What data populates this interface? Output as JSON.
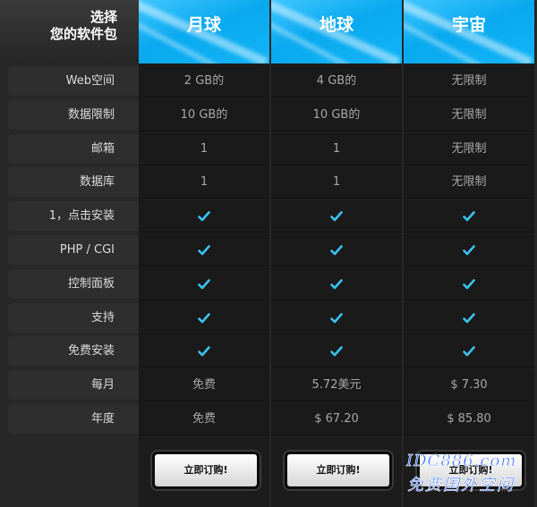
{
  "corner": {
    "line1": "选择",
    "line2": "您的软件包"
  },
  "plans": [
    {
      "name": "月球"
    },
    {
      "name": "地球"
    },
    {
      "name": "宇宙"
    }
  ],
  "rows": [
    {
      "label": "Web空间",
      "values": [
        "2 GB的",
        "4 GB的",
        "无限制"
      ]
    },
    {
      "label": "数据限制",
      "values": [
        "10 GB的",
        "10 GB的",
        "无限制"
      ]
    },
    {
      "label": "邮箱",
      "values": [
        "1",
        "1",
        "无限制"
      ]
    },
    {
      "label": "数据库",
      "values": [
        "1",
        "1",
        "无限制"
      ]
    },
    {
      "label": "1，点击安装",
      "values": [
        "check",
        "check",
        "check"
      ]
    },
    {
      "label": "PHP / CGI",
      "values": [
        "check",
        "check",
        "check"
      ]
    },
    {
      "label": "控制面板",
      "values": [
        "check",
        "check",
        "check"
      ]
    },
    {
      "label": "支持",
      "values": [
        "check",
        "check",
        "check"
      ]
    },
    {
      "label": "免费安装",
      "values": [
        "check",
        "check",
        "check"
      ]
    },
    {
      "label": "每月",
      "values": [
        "免费",
        "5.72美元",
        "$ 7.30"
      ]
    },
    {
      "label": "年度",
      "values": [
        "免费",
        "$ 67.20",
        "$ 85.80"
      ]
    }
  ],
  "order_button_label": "立即订购!",
  "watermark": {
    "line1": "IDC886.com",
    "line2": "免费国外空间"
  },
  "colors": {
    "accent": "#12b4f7",
    "check": "#3cc3f2"
  }
}
